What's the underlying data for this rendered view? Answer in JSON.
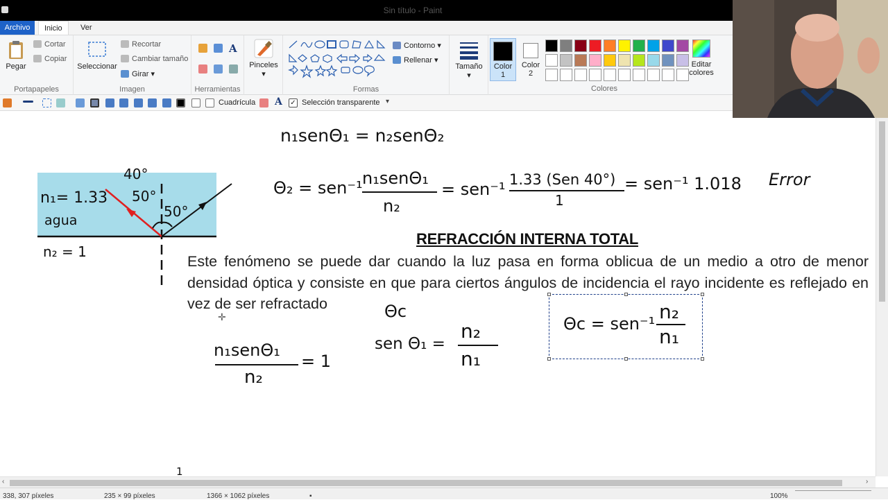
{
  "window": {
    "title": "Sin título - Paint"
  },
  "tabs": {
    "file": "Archivo",
    "home": "Inicio",
    "view": "Ver"
  },
  "ribbon": {
    "clipboard": {
      "paste": "Pegar",
      "cut": "Cortar",
      "copy": "Copiar",
      "label": "Portapapeles"
    },
    "image": {
      "select": "Seleccionar",
      "crop": "Recortar",
      "resize": "Cambiar tamaño",
      "rotate": "Girar",
      "label": "Imagen"
    },
    "tools": {
      "label": "Herramientas"
    },
    "brushes": {
      "label": "Pinceles"
    },
    "shapes": {
      "outline": "Contorno",
      "fill": "Rellenar",
      "label": "Formas"
    },
    "size": {
      "label": "Tamaño"
    },
    "color1": {
      "label": "Color",
      "num": "1"
    },
    "color2": {
      "label": "Color",
      "num": "2"
    },
    "colors": {
      "label": "Colores",
      "edit1": "Editar",
      "edit2": "colores"
    }
  },
  "qat": {
    "grid": "Cuadrícula",
    "transparent": "Selección transparente"
  },
  "palette": {
    "row1": [
      "#000000",
      "#7f7f7f",
      "#880015",
      "#ed1c24",
      "#ff7f27",
      "#fff200",
      "#22b14c",
      "#00a2e8",
      "#3f48cc",
      "#a349a4"
    ],
    "row2": [
      "#ffffff",
      "#c3c3c3",
      "#b97a57",
      "#ffaec9",
      "#ffc90e",
      "#efe4b0",
      "#b5e61d",
      "#99d9ea",
      "#7092be",
      "#c8bfe7"
    ]
  },
  "canvas": {
    "heading": "REFRACCIÓN INTERNA TOTAL",
    "paragraph": "Este fenómeno se puede dar cuando la luz pasa en forma oblicua de un medio a otro de menor densidad óptica y consiste en que para ciertos ángulos de incidencia el rayo incidente es reflejado en vez de ser refractado",
    "diagram": {
      "n1": "n₁= 1.33",
      "medium": "agua",
      "n2": "n₂ = 1",
      "angle_top": "40°",
      "angle_left": "50°",
      "angle_right": "50°"
    },
    "eq_snell": "n₁senΘ₁ = n₂senΘ₂",
    "eq_theta2": {
      "lhs": "Θ₂ = sen⁻¹",
      "num": "n₁senΘ₁",
      "den": "n₂",
      "mid": "= sen⁻¹",
      "num2": "1.33 (Sen 40°)",
      "den2": "1",
      "rhs": "= sen⁻¹ 1.018"
    },
    "error": "Error",
    "theta_c": "Θc",
    "eq_ratio": {
      "num": "n₁senΘ₁",
      "den": "n₂",
      "rhs": "= 1"
    },
    "eq_sin": {
      "lhs": "sen Θ₁ =",
      "num": "n₂",
      "den": "n₁"
    },
    "eq_box": {
      "lhs": "Θc = sen⁻¹",
      "num": "n₂",
      "den": "n₁"
    },
    "page_mark": "1"
  },
  "status": {
    "cursor": "338, 307 píxeles",
    "selection": "235 × 99 píxeles",
    "size": "1366 × 1062 píxeles",
    "zoom": "100%"
  }
}
